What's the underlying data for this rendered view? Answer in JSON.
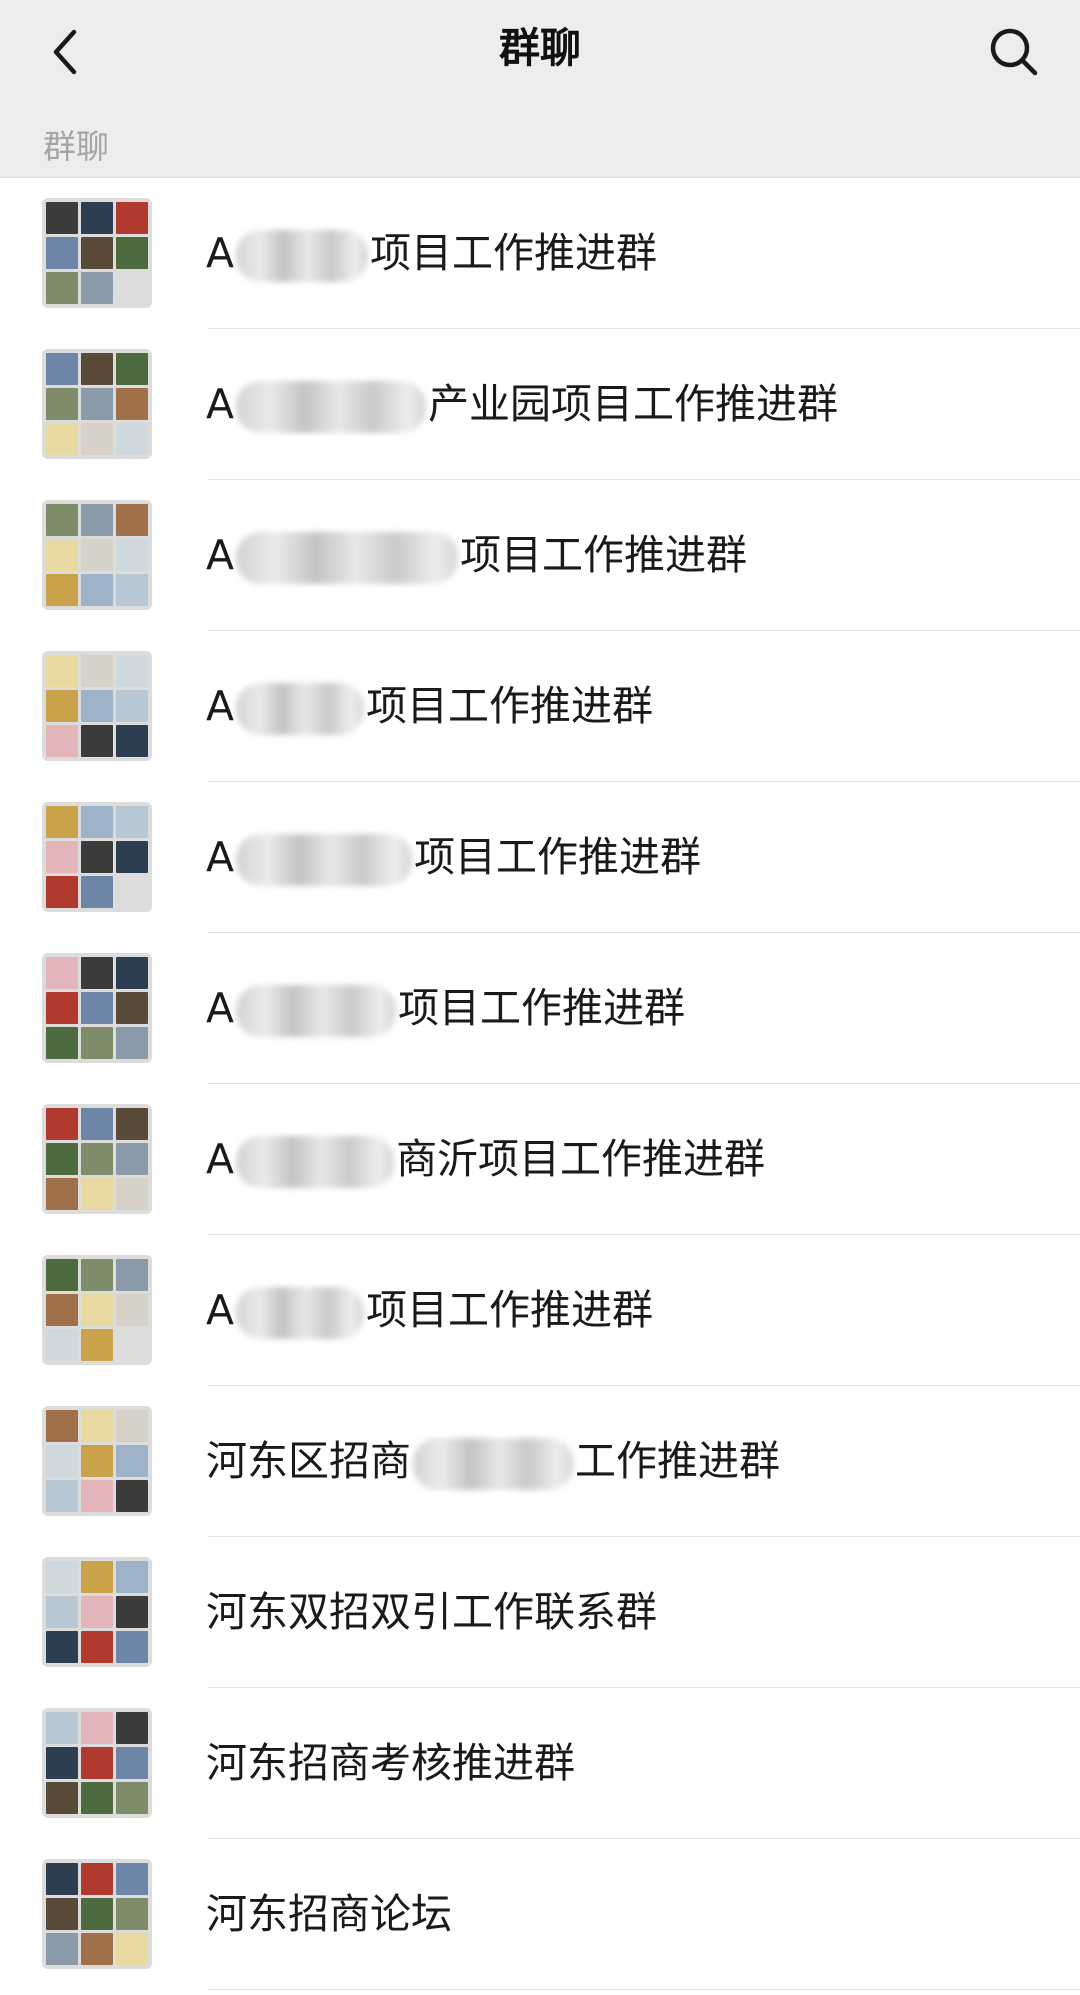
{
  "header": {
    "title": "群聊",
    "back_icon": "back-chevron-icon",
    "search_icon": "search-icon"
  },
  "section": {
    "label": "群聊"
  },
  "groups": [
    {
      "prefix": "A",
      "suffix": "项目工作推进群"
    },
    {
      "prefix": "A",
      "suffix": "产业园项目工作推进群"
    },
    {
      "prefix": "A",
      "suffix": "项目工作推进群"
    },
    {
      "prefix": "A",
      "suffix": "项目工作推进群"
    },
    {
      "prefix": "A",
      "suffix": "项目工作推进群"
    },
    {
      "prefix": "A",
      "suffix": "项目工作推进群"
    },
    {
      "prefix": "A",
      "suffix": "商沂项目工作推进群"
    },
    {
      "prefix": "A",
      "suffix": "项目工作推进群"
    },
    {
      "prefix": "河东区招商",
      "suffix": "工作推进群"
    },
    {
      "prefix": "河东双招双引工作联系群",
      "suffix": ""
    },
    {
      "prefix": "河东招商考核推进群",
      "suffix": ""
    },
    {
      "prefix": "河东招商论坛",
      "suffix": ""
    }
  ]
}
